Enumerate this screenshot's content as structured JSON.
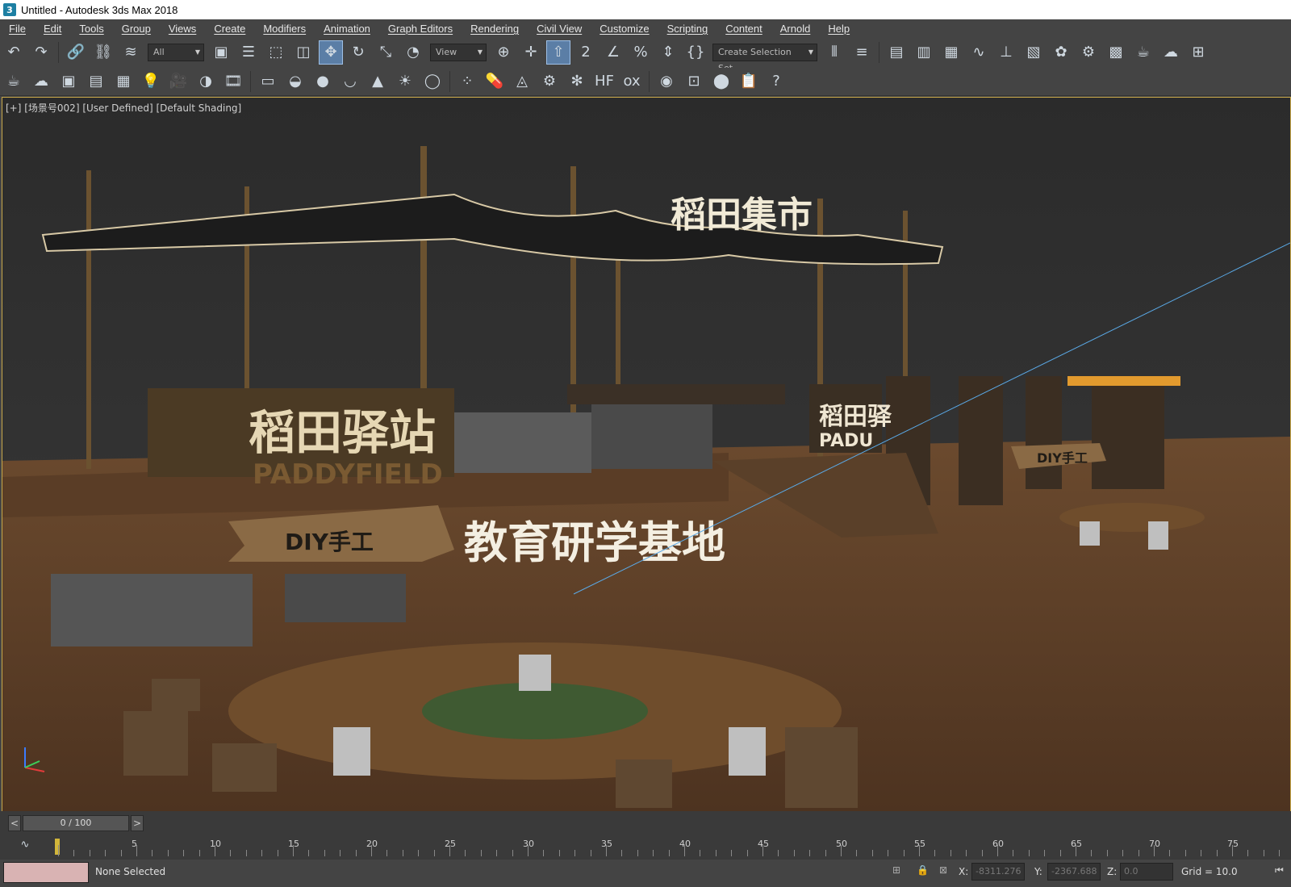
{
  "window": {
    "title": "Untitled - Autodesk 3ds Max 2018"
  },
  "menu": [
    "File",
    "Edit",
    "Tools",
    "Group",
    "Views",
    "Create",
    "Modifiers",
    "Animation",
    "Graph Editors",
    "Rendering",
    "Civil View",
    "Customize",
    "Scripting",
    "Content",
    "Arnold",
    "Help"
  ],
  "toolbar": {
    "selection_filter": "All",
    "ref_coord": "View",
    "named_selection": "Create Selection Set"
  },
  "viewport": {
    "label": "[+] [场景号002] [User Defined] [Default Shading]",
    "signs": {
      "canopy_sign": "稻田集市",
      "station_sign": "稻田驿站",
      "station_sub": "PADDYFIELD",
      "diy_sign_left": "DIY手工",
      "diy_sign_right": "DIY手工",
      "base_sign": "教育研学基地",
      "side_sign": "稻田驿",
      "side_sub": "PADU"
    }
  },
  "timeline": {
    "frame": "0 / 100",
    "ticks": [
      "5",
      "10",
      "15",
      "20",
      "25",
      "30",
      "35",
      "40",
      "45",
      "50",
      "55",
      "60",
      "65",
      "70",
      "75"
    ]
  },
  "status": {
    "selection": "None Selected",
    "x_label": "X:",
    "x_value": "-8311.276",
    "y_label": "Y:",
    "y_value": "-2367.688",
    "z_label": "Z:",
    "z_value": "0.0",
    "grid": "Grid = 10.0"
  },
  "colors": {
    "accent": "#c8a84a",
    "active_button": "#5b7ea6"
  }
}
